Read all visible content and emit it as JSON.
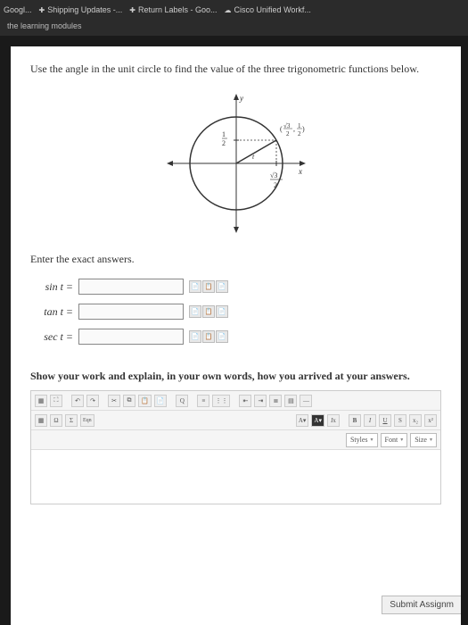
{
  "tabs": [
    {
      "label": "Googl..."
    },
    {
      "label": "Shipping Updates -..."
    },
    {
      "label": "Return Labels - Goo..."
    },
    {
      "label": "Cisco Unified Workf..."
    }
  ],
  "subheader": "the learning modules",
  "question": "Use the angle in the unit circle to find the value of the three trigonometric functions below.",
  "diagram": {
    "y_axis": "y",
    "x_axis": "x",
    "point_label": "(√3/2 , 1/2)",
    "y_tick": "1/2",
    "x_tick": "√3/2",
    "angle_label": "t"
  },
  "enter_label": "Enter the exact answers.",
  "answers": [
    {
      "label": "sin t ="
    },
    {
      "label": "tan t ="
    },
    {
      "label": "sec t ="
    }
  ],
  "show_work": "Show your work and explain, in your own words, how you arrived at your answers.",
  "toolbar": {
    "styles": "Styles",
    "font": "Font",
    "size": "Size"
  },
  "submit": "Submit Assignm"
}
